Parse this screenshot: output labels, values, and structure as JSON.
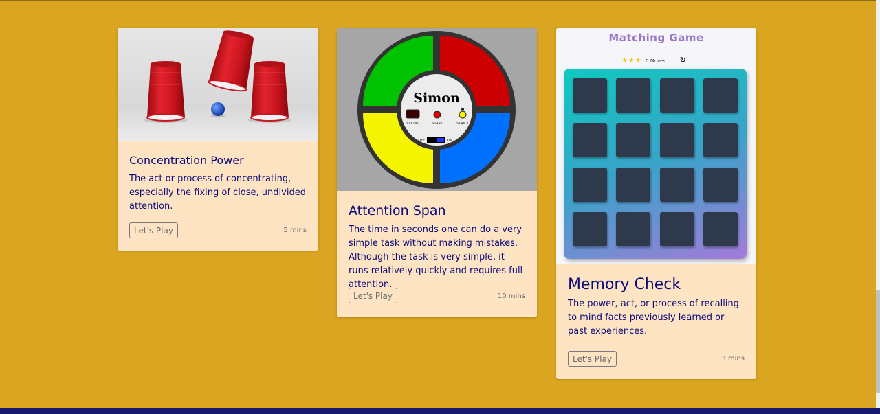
{
  "cards": [
    {
      "title": "Concentration Power",
      "description": "The act or process of concentrating, especially the fixing of close, undivided attention.",
      "button_label": "Let's Play",
      "duration": "5 mins",
      "image": "cups-and-ball-image"
    },
    {
      "title": "Attention Span",
      "description": "The time in seconds one can do a very simple task without making mistakes. Although the task is very simple, it runs relatively quickly and requires full attention.",
      "button_label": "Let's Play",
      "duration": "10 mins",
      "image": {
        "title": "Simon",
        "count_display": "--",
        "count_label": "COUNT",
        "start_label": "START",
        "strict_label": "STRICT",
        "off_label": "OFF",
        "on_label": "ON",
        "colors": {
          "green": "#00c200",
          "red": "#cc0000",
          "yellow": "#f5f500",
          "blue": "#0070ff"
        }
      }
    },
    {
      "title": "Memory Check",
      "description": "The power, act, or process of recalling to mind facts previously learned or past experiences.",
      "button_label": "Let's Play",
      "duration": "3 mins",
      "image": {
        "title": "Matching Game",
        "stars": "★★★",
        "moves": "0 Moves",
        "restart_icon": "↻"
      }
    }
  ],
  "colors": {
    "page_background": "#daa520",
    "card_background": "#ffe4c4",
    "text": "#0b0b7a",
    "footer": "#191970"
  }
}
